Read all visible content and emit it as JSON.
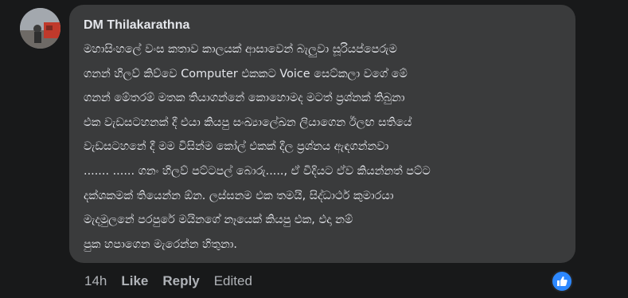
{
  "comment": {
    "author": "DM Thilakarathna",
    "lines": [
      "මහාසිංහලේ වංස කතාව කාලයක් ආසාවෙන් බැලුවා සූරියප්පෙරුම",
      "ගනන් හිලව් කිව්වෙ Computer එකකට Voice සෙට්කලා වගේ මේ",
      "ගනන් මේතරම් මතක තියාගන්නේ කොහොමද මටත් ප්‍රශ්නක් තිබුනා",
      "එක වැඩසටහනක් දී එයා කියපු සංඛ්‍යාලේඛන ලියාගෙන ඊලඟ සතියේ",
      "වැඩසටහනේ දී මම විසින්ම කෝල් එකක් දීල ප්‍රශ්නය ඇඳගන්නවා",
      "....... ...... ගනං හිලව් පට්ටපල් බොරු....., ඒ විදියට ඒව කියන්නත් පට්ට",
      "දක්ශකමක් තියෙන්න ඕන. ලස්සනම එක තමයි, සිද්ධාර්ථ කුමාරයා",
      "මැදමුලනේ පරපුරේ මයිනගේ නෑයෙක් කියපු එක, එදා නම්",
      "පුක හපාගෙන මැරෙන්න හිතුනා."
    ],
    "time": "14h",
    "like_label": "Like",
    "reply_label": "Reply",
    "edited_label": "Edited",
    "reaction_icon": "thumbs-up-icon",
    "colors": {
      "background": "#18191a",
      "bubble": "#3a3b3c",
      "text": "#e4e6eb",
      "muted": "#b0b3b8",
      "like_blue": "#2d88ff"
    }
  }
}
